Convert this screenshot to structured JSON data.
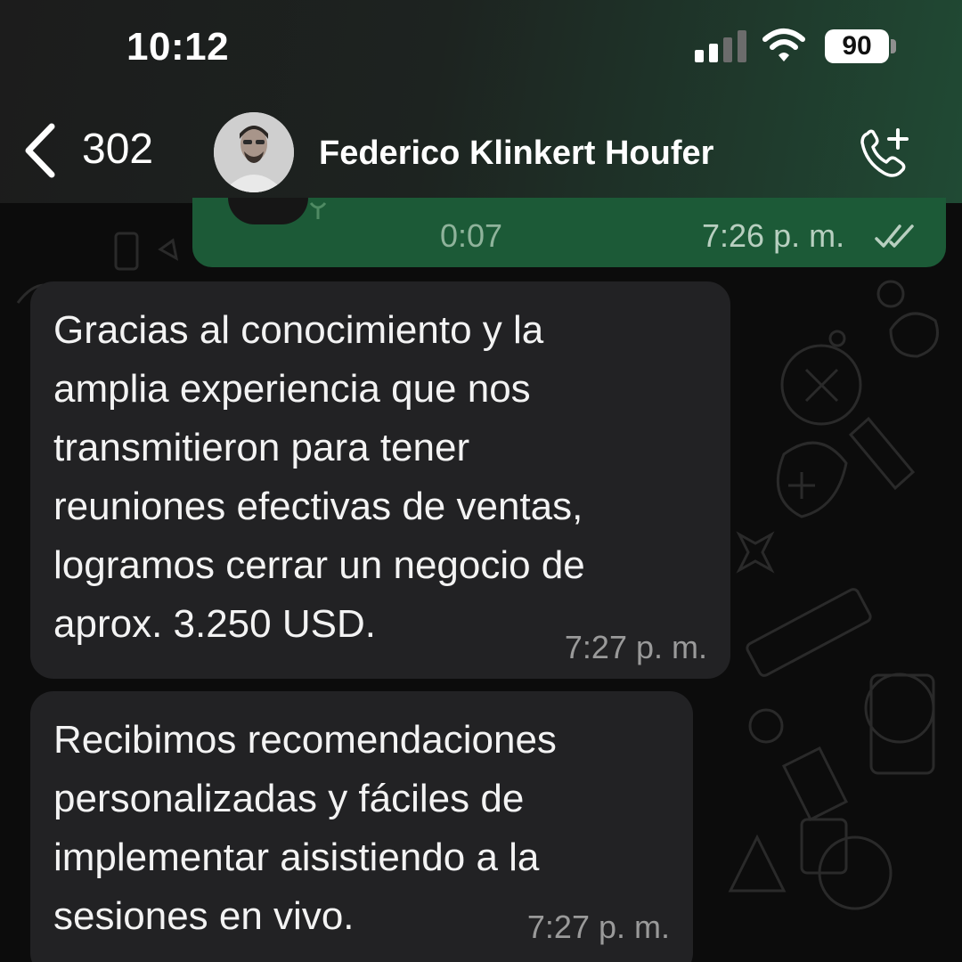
{
  "status_bar": {
    "time": "10:12",
    "battery": "90",
    "signal_icon": "cellular-signal-icon",
    "wifi_icon": "wifi-icon"
  },
  "chat_header": {
    "back_count": "302",
    "contact_name": "Federico Klinkert Houfer",
    "call_icon": "add-call-icon",
    "accent_color": "#1f5a38"
  },
  "messages": [
    {
      "type": "voice",
      "direction": "outgoing",
      "duration": "0:07",
      "time": "7:26 p. m.",
      "status_icon": "double-check-icon"
    },
    {
      "type": "text",
      "direction": "incoming",
      "text": "Gracias al conocimiento y la\namplia experiencia que nos\ntransmitieron para tener\nreuniones efectivas de ventas,\nlogramos cerrar un negocio de\naprox. 3.250 USD.",
      "time": "7:27 p. m."
    },
    {
      "type": "text",
      "direction": "incoming",
      "text": "Recibimos recomendaciones\npersonalizadas y fáciles de\nimplementar aisistiendo a la\nsesiones en vivo.",
      "time": "7:27 p. m."
    }
  ]
}
